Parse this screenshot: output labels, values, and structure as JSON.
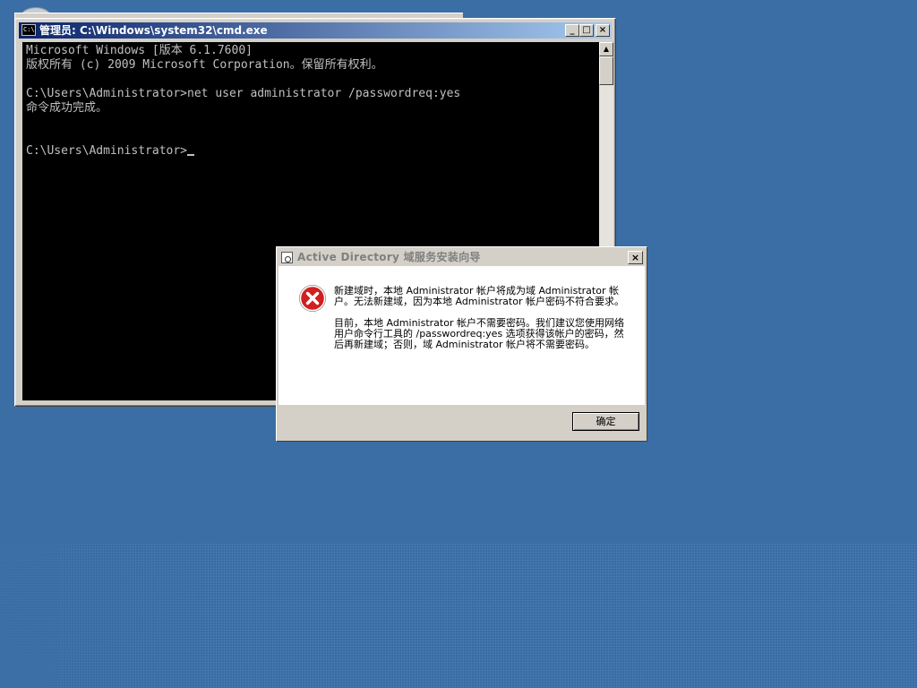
{
  "cmd_window": {
    "title": "管理员: C:\\Windows\\system32\\cmd.exe",
    "icon_label": "C:\\",
    "minimize_glyph": "_",
    "maximize_glyph": "□",
    "close_glyph": "×",
    "lines": [
      "Microsoft Windows [版本 6.1.7600]",
      "版权所有 (c) 2009 Microsoft Corporation。保留所有权利。",
      "",
      "C:\\Users\\Administrator>net user administrator /passwordreq:yes",
      "命令成功完成。",
      "",
      "",
      "C:\\Users\\Administrator>"
    ],
    "scroll_up_glyph": "▲",
    "scroll_down_glyph": "▼"
  },
  "dialog": {
    "title": "Active Directory 域服务安装向导",
    "close_glyph": "×",
    "icon": "error-icon",
    "message_1": "新建域时，本地 Administrator 帐户将成为域 Administrator 帐户。无法新建域，因为本地 Administrator 帐户密码不符合要求。",
    "message_2": "目前，本地 Administrator 帐户不需要密码。我们建议您使用网络用户命令行工具的 /passwordreq:yes 选项获得该帐户的密码，然后再新建域；否则，域 Administrator 帐户将不需要密码。",
    "ok_label": "确定"
  },
  "colors": {
    "desktop": "#3a6ea5",
    "console_bg": "#000000",
    "console_fg": "#c0c0c0",
    "error_red": "#d21f1f"
  }
}
